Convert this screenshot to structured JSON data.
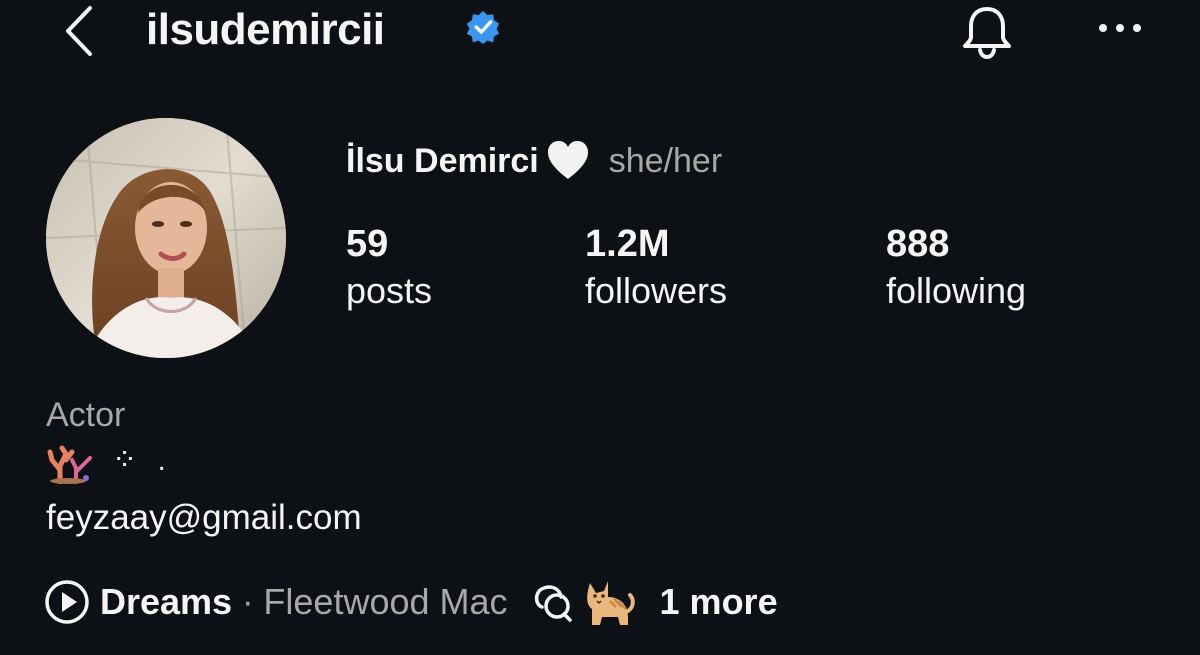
{
  "header": {
    "username": "ilsudemircii",
    "verified": true,
    "back_icon": "chevron-left-icon",
    "bell_icon": "bell-icon",
    "more_icon": "ellipsis-icon",
    "accent_color": "#3897f0"
  },
  "profile": {
    "avatar_icon": "profile-photo",
    "display_name": "İlsu Demirci",
    "name_emoji": "white-heart-icon",
    "pronouns": "she/her"
  },
  "stats": [
    {
      "value": "59",
      "label": "posts"
    },
    {
      "value": "1.2M",
      "label": "followers"
    },
    {
      "value": "888",
      "label": "following"
    }
  ],
  "bio": {
    "category": "Actor",
    "emoji": "coral-icon",
    "dots": "⁘ .",
    "email": "feyzaay@gmail.com"
  },
  "music": {
    "play_icon": "play-circle-icon",
    "song": "Dreams",
    "separator": "·",
    "artist": "Fleetwood Mac",
    "threads_icon": "threads-icon",
    "cat_emoji": "cat-icon",
    "more_label": "1 more"
  },
  "colors": {
    "background": "#0d1014",
    "primary_text": "#f5f5f5",
    "secondary_text": "#a8a8a8",
    "verified_badge": "#3897f0"
  }
}
